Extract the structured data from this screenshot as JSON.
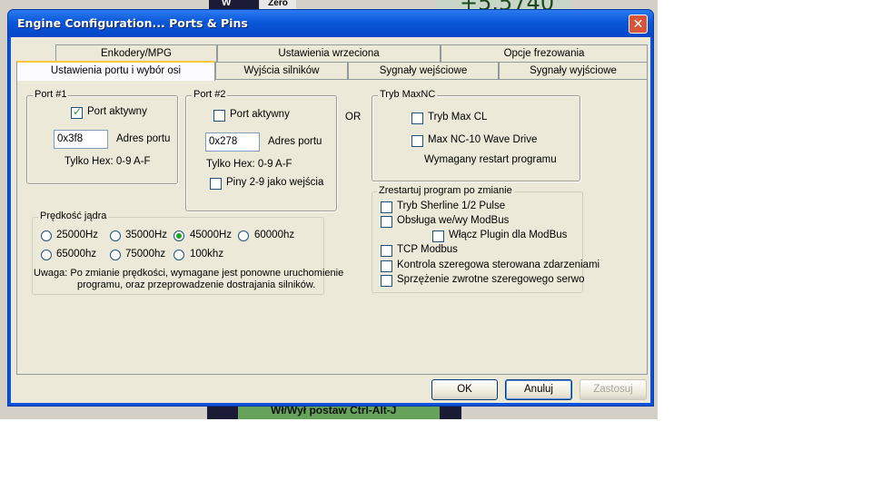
{
  "background": {
    "lcd_value": "+5.5740",
    "zero_label": "Zero",
    "w_label": "W",
    "footer_text": "Wł/Wył postaw Ctrl-Alt-J"
  },
  "window": {
    "title": "Engine Configuration... Ports & Pins",
    "close_glyph": "✕"
  },
  "tabs": {
    "top_row": [
      "Enkodery/MPG",
      "Ustawienia wrzeciona",
      "Opcje frezowania"
    ],
    "bottom_row": [
      "Ustawienia portu i wybór osi",
      "Wyjścia silników",
      "Sygnały wejściowe",
      "Sygnały wyjściowe"
    ]
  },
  "port1": {
    "legend": "Port #1",
    "active_label": "Port aktywny",
    "active_checked": true,
    "address_value": "0x3f8",
    "address_label": "Adres portu",
    "hex_hint": "Tylko Hex: 0-9 A-F"
  },
  "or_label": "OR",
  "port2": {
    "legend": "Port #2",
    "active_label": "Port aktywny",
    "active_checked": false,
    "address_value": "0x278",
    "address_label": "Adres portu",
    "hex_hint": "Tylko Hex: 0-9 A-F",
    "pins_label": "Piny 2-9 jako wejścia"
  },
  "maxnc": {
    "legend": "Tryb MaxNC",
    "max_cl_label": "Tryb Max CL",
    "wave_drive_label": "Max NC-10 Wave Drive",
    "restart_note": "Wymagany restart programu"
  },
  "kernel_speed": {
    "legend": "Prędkość jądra",
    "options": [
      "25000Hz",
      "35000Hz",
      "45000Hz",
      "60000hz",
      "65000hz",
      "75000hz",
      "100khz"
    ],
    "selected": "45000Hz",
    "note_line1": "Uwaga: Po zmianie prędkości, wymagane jest ponowne uruchomienie",
    "note_line2": "programu, oraz przeprowadzenie dostrajania silników."
  },
  "restart_group": {
    "legend": "Zrestartuj program po zmianie",
    "items": [
      "Tryb Sherline 1/2 Pulse",
      "Obsługa we/wy ModBus",
      "Włącz Plugin dla ModBus",
      "TCP Modbus",
      "Kontrola szeregowa sterowana zdarzeniami",
      "Sprzężenie zwrotne  szeregowego serwo"
    ]
  },
  "buttons": {
    "ok": "OK",
    "cancel": "Anuluj",
    "apply": "Zastosuj"
  }
}
